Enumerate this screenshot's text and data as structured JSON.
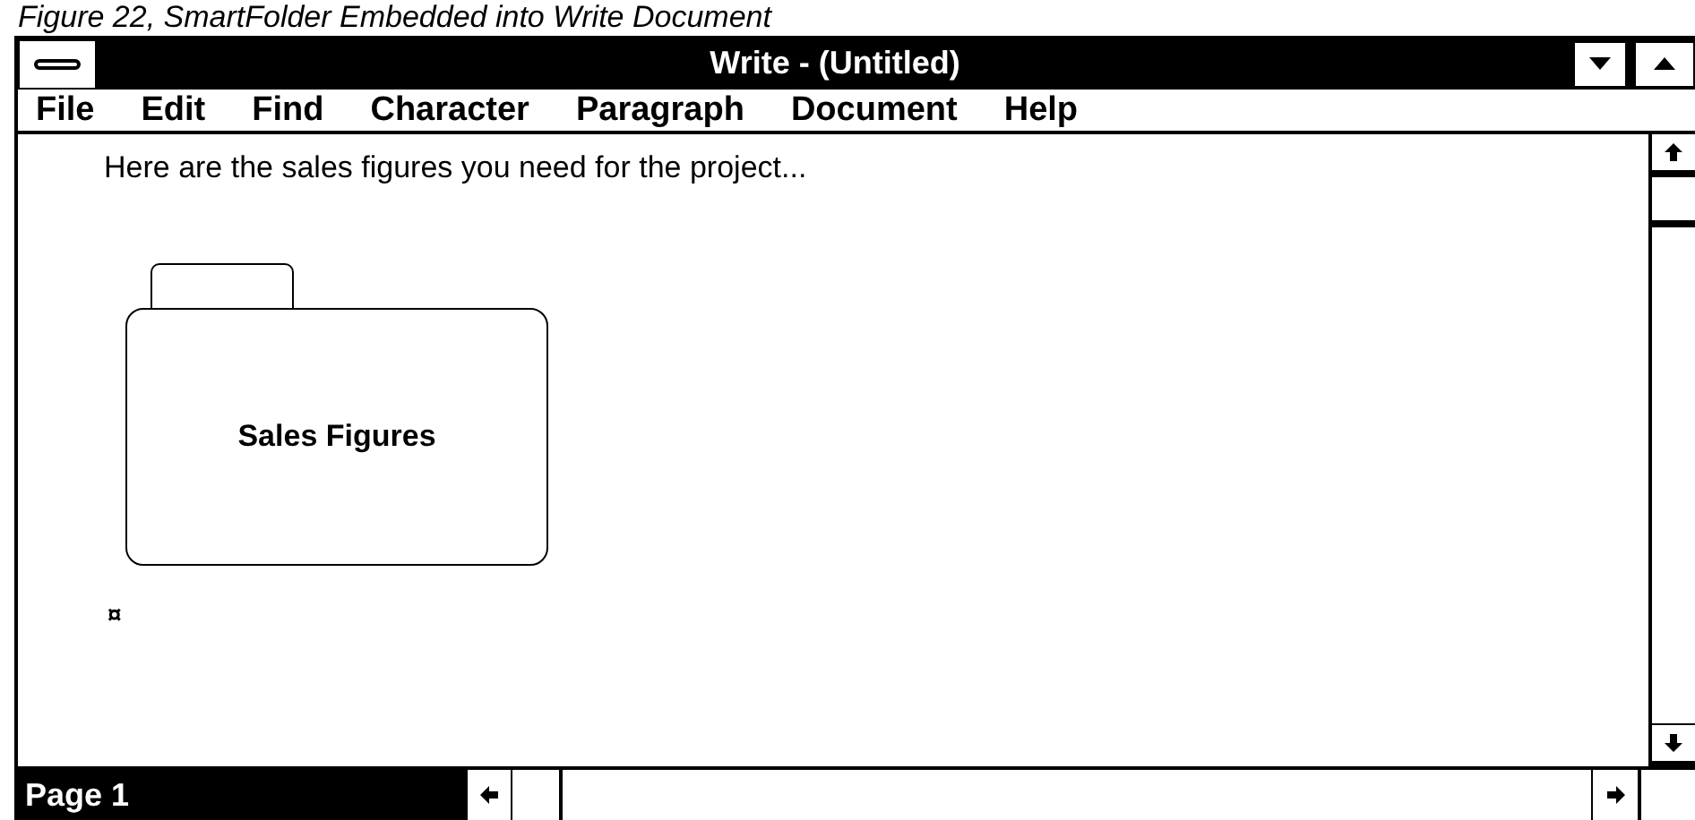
{
  "caption": "Figure 22, SmartFolder Embedded into Write Document",
  "window": {
    "title": "Write - (Untitled)"
  },
  "menu": [
    "File",
    "Edit",
    "Find",
    "Character",
    "Paragraph",
    "Document",
    "Help"
  ],
  "document": {
    "text": "Here are the sales figures you need for the project...",
    "embedded_folder": {
      "label": "Sales Figures"
    },
    "end_mark": "¤"
  },
  "status_bar": {
    "page": "Page 1"
  }
}
